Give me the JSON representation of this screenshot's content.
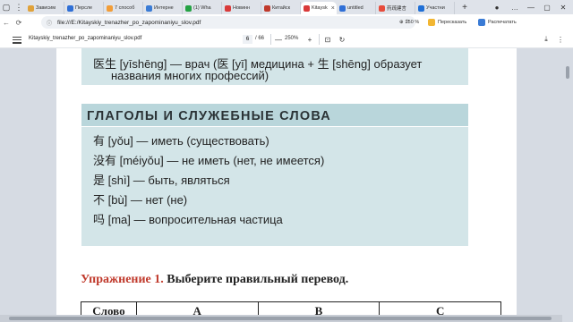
{
  "browser": {
    "tabs": [
      {
        "label": "Зависим",
        "color": "#e0a23a"
      },
      {
        "label": "Персле",
        "color": "#2f6fd6"
      },
      {
        "label": "7 способ",
        "color": "#f29d38"
      },
      {
        "label": "Интерне",
        "color": "#3a7bd5"
      },
      {
        "label": "(1) Wha",
        "color": "#25a244"
      },
      {
        "label": "Новинн",
        "color": "#d93a3a"
      },
      {
        "label": "Китайск",
        "color": "#c0392b"
      },
      {
        "label": "Kitaysk",
        "color": "#d93a3a",
        "active": true
      },
      {
        "label": "untitled",
        "color": "#2f6fd6"
      },
      {
        "label": "药疏建言",
        "color": "#e74c3c"
      },
      {
        "label": "Участни",
        "color": "#1f6fd6"
      }
    ],
    "tab_close": "×",
    "new_tab": "+",
    "address": "file:///E:/Kitayskiy_trenazher_po_zapominaniyu_slov.pdf",
    "address_info": "File",
    "zoom_chip": "250 %",
    "extensions": [
      {
        "label": "Пересказать",
        "color": "#f2b632"
      },
      {
        "label": "Распечатать",
        "color": "#3a7bd5"
      }
    ]
  },
  "pdf_toolbar": {
    "title": "Kitayskiy_trenazher_po_zapominaniyu_slov.pdf",
    "page_current": "6",
    "page_total": "/ 66",
    "zoom": "250%",
    "zoom_out": "—",
    "zoom_in": "+"
  },
  "content": {
    "box1_line1": "医生 [yīshēng] — врач (医 [yī] медицина + 生 [shēng] образует",
    "box1_line2": "названия многих профессий)",
    "section_title": "ГЛАГОЛЫ И СЛУЖЕБНЫЕ СЛОВА",
    "vocab": [
      "有 [yǒu] — иметь (существовать)",
      "没有 [méiyǒu] — не иметь (нет, не имеется)",
      "是 [shì] — быть, являться",
      "不 [bù] — нет (не)",
      "吗 [ma] — вопросительная частица"
    ],
    "exercise_number": "Упражнение 1.",
    "exercise_text": " Выберите правильный перевод.",
    "table_headers": [
      "Слово",
      "A",
      "B",
      "C"
    ]
  }
}
